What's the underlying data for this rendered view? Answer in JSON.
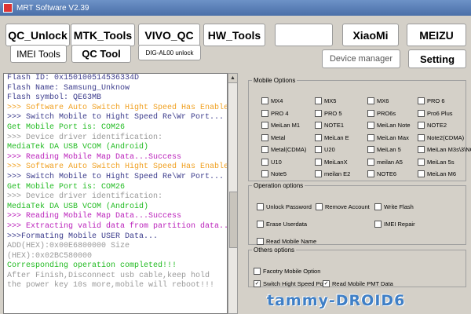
{
  "window": {
    "title": "MRT Software V2.39"
  },
  "toolbar": {
    "qc_unlock": "QC_Unlock",
    "mtk_tools": "MTK_Tools",
    "vivo_qc": "VIVO_QC",
    "hw_tools": "HW_Tools",
    "blank": "",
    "xiaomi": "XiaoMi",
    "meizu": "MEIZU",
    "imei_tools": "IMEI Tools",
    "qc_tool": "QC Tool",
    "dig_al00_unlock": "DIG-AL00 unlock",
    "device_manager": "Device manager",
    "setting": "Setting"
  },
  "console": {
    "lines": [
      {
        "text": "    Flash    ID: 0x150100514536334D",
        "color": "#3c3c8c"
      },
      {
        "text": "    Flash   Name: Samsung_Unknow",
        "color": "#3c3c8c"
      },
      {
        "text": "    Flash symbol: QE63MB",
        "color": "#3c3c8c"
      },
      {
        "text": ">>> Software Auto Switch Hight Speed Has Enable...",
        "color": "#f0a020"
      },
      {
        "text": ">>> Switch Mobile to Hight Speed Re\\Wr Port...",
        "color": "#3c3c8c"
      },
      {
        "text": "    Get Mobile Port is:  COM26",
        "color": "#22bb22"
      },
      {
        "text": ">>> Device driver identification:",
        "color": "#999999"
      },
      {
        "text": "    MediaTek DA USB VCOM (Android)",
        "color": "#22bb22"
      },
      {
        "text": ">>> Reading Mobile Map Data...Success",
        "color": "#bb22bb"
      },
      {
        "text": ">>> Software Auto Switch Hight Speed Has Enable...",
        "color": "#f0a020"
      },
      {
        "text": ">>> Switch Mobile to Hight Speed Re\\Wr Port...",
        "color": "#3c3c8c"
      },
      {
        "text": "    Get Mobile Port is:  COM26",
        "color": "#22bb22"
      },
      {
        "text": ">>> Device driver identification:",
        "color": "#999999"
      },
      {
        "text": "    MediaTek DA USB VCOM (Android)",
        "color": "#22bb22"
      },
      {
        "text": ">>> Reading Mobile Map Data...Success",
        "color": "#bb22bb"
      },
      {
        "text": ">>> Extracting valid data from partition data...",
        "color": "#bb22bb"
      },
      {
        "text": ">>>Formating Mobile USER Data...",
        "color": "#3c3c8c"
      },
      {
        "text": "    ADD(HEX):0x00E6800000    Size",
        "color": "#999999"
      },
      {
        "text": "(HEX):0x02BC580000",
        "color": "#999999"
      },
      {
        "text": "    Corresponding operation completed!!!",
        "color": "#22bb22"
      },
      {
        "text": "    After Finish,Disconnect usb cable,keep hold",
        "color": "#999999"
      },
      {
        "text": "the power key 10s more,mobile will reboot!!!",
        "color": "#999999"
      }
    ]
  },
  "mobile_options": {
    "legend": "Mobile Options",
    "items": [
      "MX4",
      "MX5",
      "MX6",
      "PRO 6",
      "PRO 4",
      "PRO 5",
      "PRO6s",
      "Pro6 Plus",
      "MeiLan M1",
      "NOTE1",
      "MeiLan Note",
      "NOTE2",
      "Metal",
      "MeiLan E",
      "MeiLan Max",
      "Note2(CDMA)",
      "Metal(CDMA)",
      "U20",
      "MeiLan 5",
      "MeiLan M3s\\3\\NOTE3",
      "U10",
      "MeiLanX",
      "meilan A5",
      "MeiLan 5s",
      "Note5",
      "meilan E2",
      "NOTE6",
      "MeiLan M6"
    ]
  },
  "operation_options": {
    "legend": "Operation options",
    "unlock_password": "Unlock Password",
    "remove_account": "Remove Account",
    "write_flash": "Write Flash",
    "erase_userdata": "Erase Userdata",
    "imei_repair": "IMEI Repair",
    "read_mobile_name": "Read Mobile Name"
  },
  "others_options": {
    "legend": "Others options",
    "factory_mobile_option": "Facotry Mobile Option",
    "switch_high_speed_port": "Switch Hight Speed Por",
    "switch_high_speed_checked": "✓",
    "read_mobile_pmt_data": "Read Mobile PMT Data",
    "read_mobile_pmt_checked": "✓"
  },
  "watermark": "tammy-DROID6"
}
